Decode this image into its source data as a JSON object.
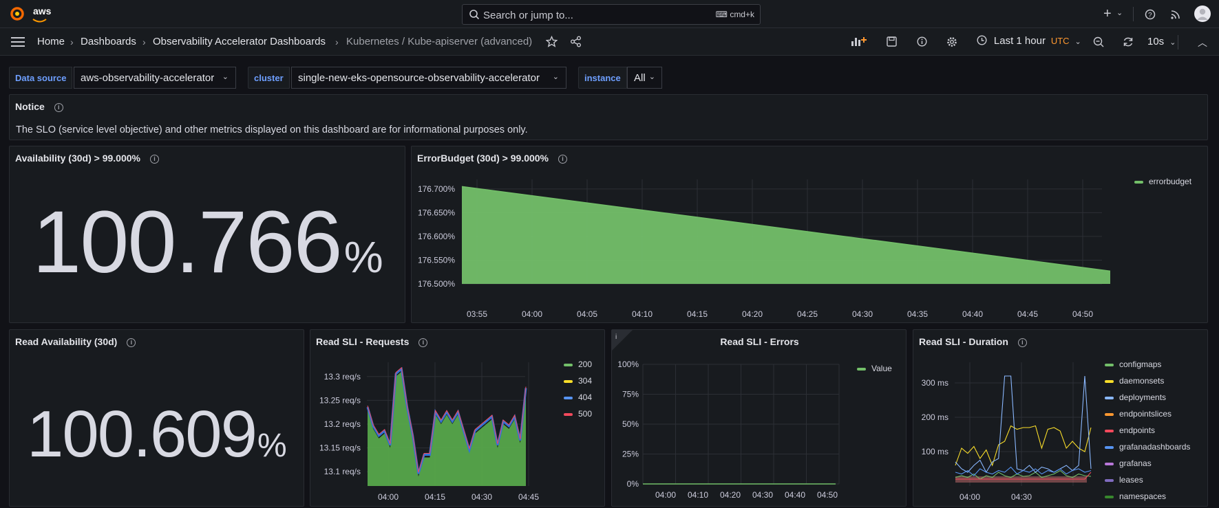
{
  "topbar": {
    "brand": "aws",
    "search_placeholder": "Search or jump to...",
    "search_shortcut": "cmd+k"
  },
  "breadcrumb": [
    "Home",
    "Dashboards",
    "Observability Accelerator Dashboards",
    "Kubernetes / Kube-apiserver (advanced)"
  ],
  "toolbar": {
    "time_range": "Last 1 hour",
    "timezone": "UTC",
    "refresh": "10s"
  },
  "variables": [
    {
      "label": "Data source",
      "value": "aws-observability-accelerator"
    },
    {
      "label": "cluster",
      "value": "single-new-eks-opensource-observability-accelerator"
    },
    {
      "label": "instance",
      "value": "All"
    }
  ],
  "notice": {
    "title": "Notice",
    "text": "The SLO (service level objective) and other metrics displayed on this dashboard are for informational purposes only."
  },
  "availability": {
    "title": "Availability (30d) > 99.000%",
    "value": "100.766",
    "unit": "%"
  },
  "read_availability": {
    "title": "Read Availability (30d)",
    "value": "100.609",
    "unit": "%"
  },
  "read_sli_errors": {
    "title": "Read SLI - Errors"
  },
  "read_sli_requests": {
    "title": "Read SLI - Requests"
  },
  "read_sli_duration": {
    "title": "Read SLI - Duration"
  },
  "colors": {
    "green": "#73bf69",
    "yellow": "#fade2a",
    "blue": "#5794f2",
    "red": "#f2495c",
    "orange": "#ff9830",
    "purple": "#b877d9",
    "lightblue": "#8ab8ff",
    "darkgreen": "#37872d"
  },
  "chart_data": [
    {
      "id": "errorbudget",
      "type": "area",
      "title": "ErrorBudget (30d) > 99.000%",
      "x_ticks": [
        "03:55",
        "04:00",
        "04:05",
        "04:10",
        "04:15",
        "04:20",
        "04:25",
        "04:30",
        "04:35",
        "04:40",
        "04:45",
        "04:50"
      ],
      "y_ticks": [
        "176.700%",
        "176.650%",
        "176.600%",
        "176.550%",
        "176.500%"
      ],
      "ylim": [
        176.5,
        176.72
      ],
      "series": [
        {
          "name": "errorbudget",
          "color": "#73bf69",
          "x": [
            "03:52",
            "04:51"
          ],
          "values": [
            176.705,
            176.527
          ]
        }
      ],
      "legend": "right"
    },
    {
      "id": "read_requests",
      "type": "area",
      "title": "Read SLI - Requests",
      "x_ticks": [
        "04:00",
        "04:15",
        "04:30",
        "04:45"
      ],
      "y_ticks": [
        "13.3 req/s",
        "13.25 req/s",
        "13.2 req/s",
        "13.15 req/s",
        "13.1 req/s"
      ],
      "ylim": [
        13.07,
        13.33
      ],
      "legend": "right",
      "series": [
        {
          "name": "200",
          "color": "#73bf69"
        },
        {
          "name": "304",
          "color": "#fade2a"
        },
        {
          "name": "404",
          "color": "#5794f2"
        },
        {
          "name": "500",
          "color": "#f2495c"
        }
      ],
      "values": [
        13.23,
        13.19,
        13.17,
        13.18,
        13.15,
        13.3,
        13.31,
        13.23,
        13.17,
        13.09,
        13.13,
        13.13,
        13.22,
        13.2,
        13.22,
        13.2,
        13.22,
        13.18,
        13.14,
        13.18,
        13.19,
        13.2,
        13.21,
        13.15,
        13.2,
        13.19,
        13.21,
        13.16,
        13.27
      ]
    },
    {
      "id": "read_errors",
      "type": "line",
      "title": "Read SLI - Errors",
      "x_ticks": [
        "04:00",
        "04:10",
        "04:20",
        "04:30",
        "04:40",
        "04:50"
      ],
      "y_ticks": [
        "100%",
        "75%",
        "50%",
        "25%",
        "0%"
      ],
      "ylim": [
        0,
        100
      ],
      "legend": "right",
      "series": [
        {
          "name": "Value",
          "color": "#73bf69",
          "values": [
            0,
            0
          ]
        }
      ]
    },
    {
      "id": "read_duration",
      "type": "line",
      "title": "Read SLI - Duration",
      "x_ticks": [
        "04:00",
        "04:30"
      ],
      "y_ticks": [
        "300 ms",
        "200 ms",
        "100 ms"
      ],
      "ylim": [
        0,
        360
      ],
      "legend": "right",
      "series": [
        {
          "name": "configmaps",
          "color": "#73bf69"
        },
        {
          "name": "daemonsets",
          "color": "#fade2a"
        },
        {
          "name": "deployments",
          "color": "#8ab8ff"
        },
        {
          "name": "endpointslices",
          "color": "#ff9830"
        },
        {
          "name": "endpoints",
          "color": "#f2495c"
        },
        {
          "name": "grafanadashboards",
          "color": "#5794f2"
        },
        {
          "name": "grafanas",
          "color": "#b877d9"
        },
        {
          "name": "leases",
          "color": "#7f6bbf"
        },
        {
          "name": "namespaces",
          "color": "#37872d"
        }
      ]
    }
  ]
}
